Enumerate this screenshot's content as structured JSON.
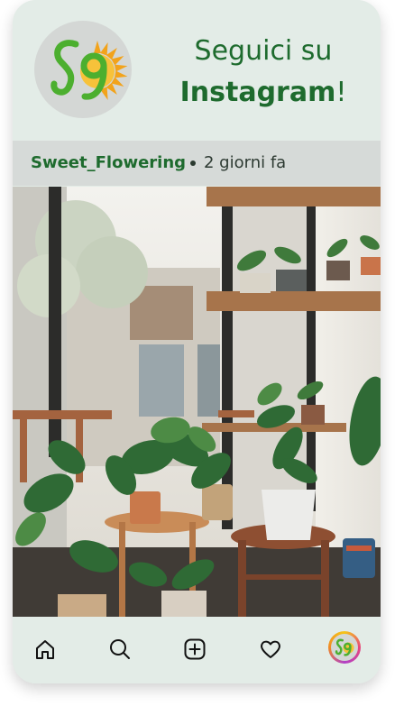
{
  "brand": {
    "logo_text": "S9",
    "colors": {
      "green": "#1e6b2e",
      "leaf_green": "#4caf2f",
      "sun_orange": "#f2a31b",
      "background": "#e3ece7"
    }
  },
  "header": {
    "headline_line1": "Seguici su",
    "headline_line2_bold": "Instagram",
    "headline_line2_suffix": "!"
  },
  "post": {
    "username": "Sweet_Flowering",
    "separator": "•",
    "time": "2 giorni fa",
    "image_alt": "Interno con piante in vaso su sgabelli di legno e mensole vicino a una finestra"
  },
  "nav": {
    "items": [
      {
        "icon": "home-icon"
      },
      {
        "icon": "search-icon"
      },
      {
        "icon": "add-post-icon"
      },
      {
        "icon": "heart-icon"
      },
      {
        "icon": "profile-avatar"
      }
    ]
  }
}
